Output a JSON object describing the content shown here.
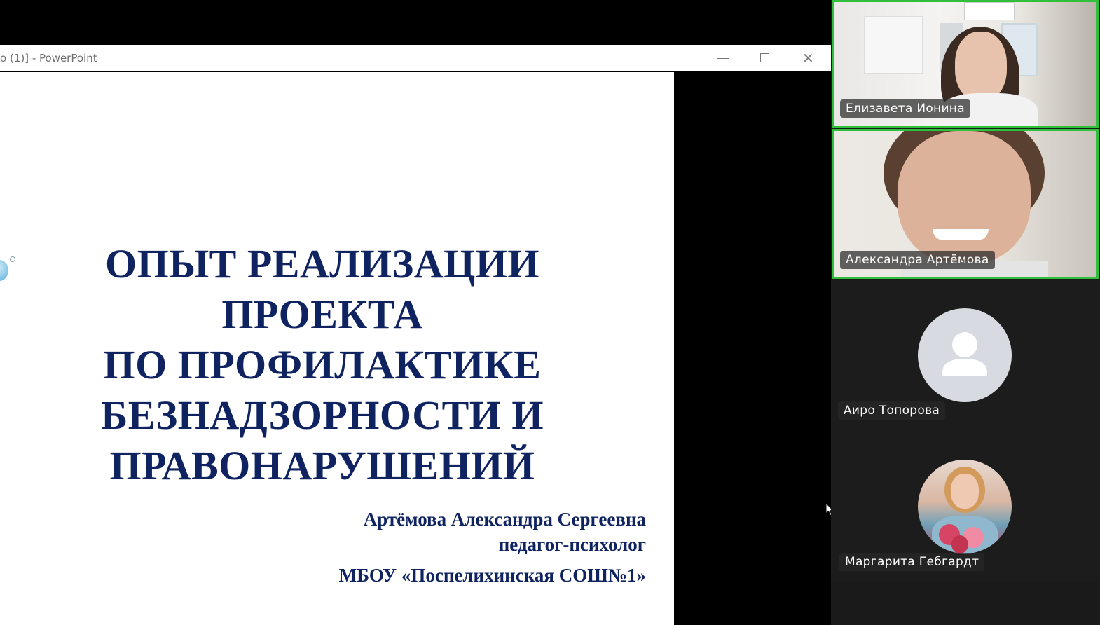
{
  "powerpoint": {
    "window_title": "o (1)] - PowerPoint",
    "buttons": {
      "minimize": "minimize",
      "maximize": "maximize",
      "close": "✕"
    }
  },
  "slide": {
    "title_lines": [
      "ОПЫТ РЕАЛИЗАЦИИ",
      "ПРОЕКТА",
      "ПО ПРОФИЛАКТИКЕ",
      "БЕЗНАДЗОРНОСТИ И",
      "ПРАВОНАРУШЕНИЙ"
    ],
    "author_name": "Артёмова Александра Сергеевна",
    "author_role": "педагог-психолог",
    "school": "МБОУ «Поспелихинская СОШ№1»"
  },
  "participants": [
    {
      "name": "Елизавета Ионина",
      "type": "video",
      "active": true
    },
    {
      "name": "Александра Артёмова",
      "type": "video",
      "active": true
    },
    {
      "name": "Аиро Топорова",
      "type": "avatar-placeholder",
      "active": false
    },
    {
      "name": "Маргарита Гебгардт",
      "type": "avatar-photo",
      "active": false
    }
  ],
  "colors": {
    "slide_text": "#0f2360",
    "active_border": "#2fbf3a",
    "panel_bg": "#1a1a1a"
  },
  "icons": {
    "cursor": "mouse-pointer-icon",
    "placeholder_avatar": "user-silhouette-icon"
  }
}
